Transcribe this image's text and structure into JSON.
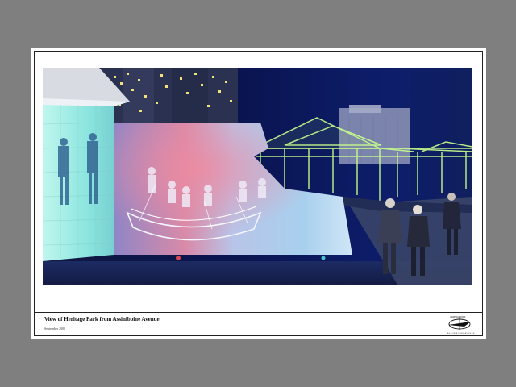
{
  "caption": {
    "title": "View of Heritage Park from Assiniboine Avenue",
    "date": "September 2005"
  },
  "logo": {
    "icon": "compass-logo-icon",
    "top_text": "HERITAGE PARK",
    "bottom_text": "ASSINIBOINE AVENUE"
  },
  "colors": {
    "background": "#7f7f7f",
    "sheet": "#ffffff",
    "night_sky": "#0b1347",
    "glow_cyan": "#8ff0e8",
    "canopy_green": "#c8ff8c"
  }
}
